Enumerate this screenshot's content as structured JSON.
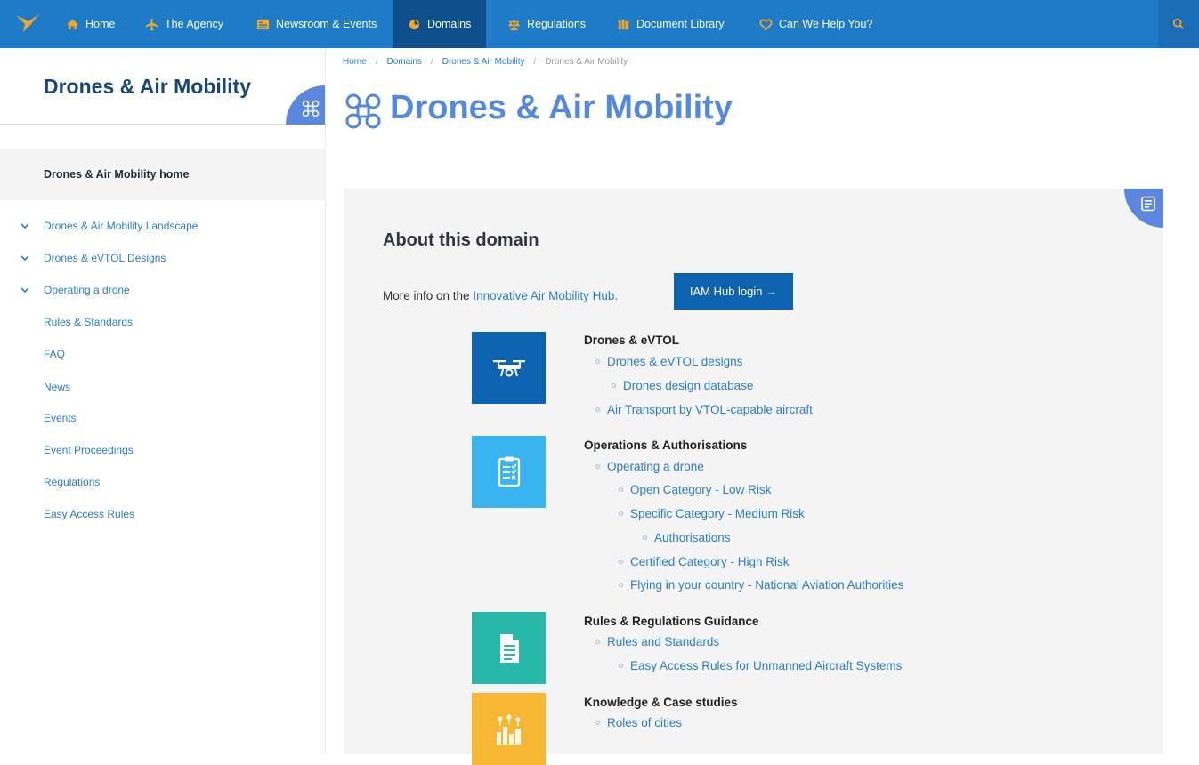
{
  "nav": {
    "items": [
      {
        "label": "Home"
      },
      {
        "label": "The Agency"
      },
      {
        "label": "Newsroom & Events"
      },
      {
        "label": "Domains"
      },
      {
        "label": "Regulations"
      },
      {
        "label": "Document Library"
      },
      {
        "label": "Can We Help You?"
      }
    ]
  },
  "sidebar": {
    "title": "Drones & Air Mobility",
    "home": "Drones & Air Mobility home",
    "items": [
      {
        "label": "Drones & Air Mobility Landscape"
      },
      {
        "label": "Drones & eVTOL Designs"
      },
      {
        "label": "Operating a drone"
      },
      {
        "label": "Rules & Standards"
      },
      {
        "label": "FAQ"
      },
      {
        "label": "News"
      },
      {
        "label": "Events"
      },
      {
        "label": "Event Proceedings"
      },
      {
        "label": "Regulations"
      },
      {
        "label": "Easy Access Rules"
      }
    ]
  },
  "breadcrumb": [
    "Home",
    "Domains",
    "Drones & Air Mobility",
    "Drones & Air Mobility"
  ],
  "page_title": "Drones & Air Mobility",
  "about": {
    "title": "About this domain",
    "more_info_prefix": "More info on the",
    "more_info_link": "Innovative Air Mobility Hub.",
    "button": "IAM Hub login →"
  },
  "sections": [
    {
      "title": "Drones & eVTOL",
      "color": "#0d63b0",
      "icon": "drone-icon",
      "links": [
        "Drones & eVTOL designs",
        "Drones design database",
        "Air Transport by VTOL-capable aircraft"
      ]
    },
    {
      "title": "Operations & Authorisations",
      "color": "#3ab4f0",
      "icon": "clipboard-icon",
      "links": [
        "Operating a drone",
        "Open Category - Low Risk",
        "Specific Category - Medium Risk",
        "Authorisations",
        "Certified Category - High Risk",
        "Flying in your country - National Aviation Authorities"
      ]
    },
    {
      "title": "Rules & Regulations Guidance",
      "color": "#27b8a9",
      "icon": "document-icon",
      "links": [
        "Rules and Standards",
        "Easy Access Rules for Unmanned Aircraft Systems"
      ]
    },
    {
      "title": "Knowledge & Case studies",
      "color": "#f7b733",
      "icon": "city-icon",
      "links": [
        "Roles of cities"
      ]
    }
  ]
}
